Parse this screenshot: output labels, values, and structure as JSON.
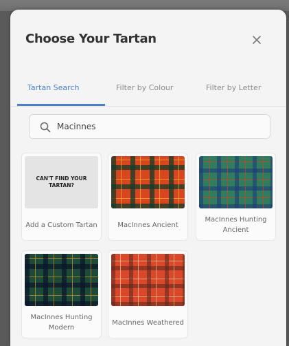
{
  "modal": {
    "title": "Choose Your Tartan",
    "close_icon": "close-icon"
  },
  "tabs": [
    {
      "label": "Tartan Search",
      "active": true
    },
    {
      "label": "Filter by Colour",
      "active": false
    },
    {
      "label": "Filter by Letter",
      "active": false
    }
  ],
  "search": {
    "icon": "search-icon",
    "value": "Macinnes"
  },
  "tartans": [
    {
      "name": "Add a Custom Tartan",
      "swatch_text": "CAN'T FIND YOUR TARTAN?",
      "type": "custom"
    },
    {
      "name": "MacInnes Ancient",
      "type": "tartan"
    },
    {
      "name": "MacInnes Hunting Ancient",
      "type": "tartan"
    },
    {
      "name": "MacInnes Hunting Modern",
      "type": "tartan"
    },
    {
      "name": "MacInnes Weathered",
      "type": "tartan"
    }
  ],
  "colors": {
    "accent": "#4d7fc9",
    "panel": "#f4f4f4",
    "title": "#333333"
  }
}
